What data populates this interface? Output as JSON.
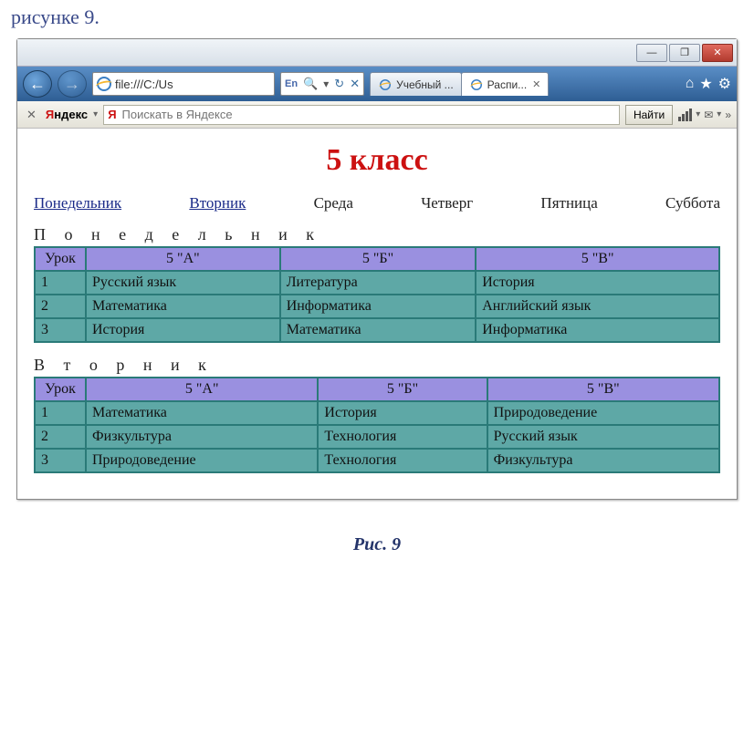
{
  "outer_text": "рисунке 9.",
  "window": {
    "minimize": "—",
    "maximize": "❐",
    "close": "✕"
  },
  "address": {
    "url": "file:///C:/Us",
    "lang": "En",
    "search_glyph": "🔍",
    "dropdown": "▾",
    "refresh": "↻",
    "stop": "✕"
  },
  "tabs": [
    {
      "label": "Учебный ..."
    },
    {
      "label": "Распи...",
      "active": true
    }
  ],
  "navright": {
    "home": "⌂",
    "star": "★",
    "gear": "⚙"
  },
  "yandex": {
    "close": "✕",
    "logo_black": "ндекс",
    "logo_red": "Я",
    "dropdown": "▾",
    "search_prefix_red": "Я",
    "placeholder": "Поискать в Яндексе",
    "find": "Найти",
    "mail": "✉",
    "more": "»"
  },
  "page": {
    "title": "5 класс",
    "days": [
      "Понедельник",
      "Вторник",
      "Среда",
      "Четверг",
      "Пятница",
      "Суббота"
    ],
    "day_links": [
      true,
      true,
      false,
      false,
      false,
      false
    ],
    "sections": [
      {
        "title": "Понедельник",
        "headers": [
          "Урок",
          "5 \"А\"",
          "5 \"Б\"",
          "5 \"В\""
        ],
        "rows": [
          [
            "1",
            "Русский язык",
            "Литература",
            "История"
          ],
          [
            "2",
            "Математика",
            "Информатика",
            "Английский язык"
          ],
          [
            "3",
            "История",
            "Математика",
            "Информатика"
          ]
        ]
      },
      {
        "title": "Вторник",
        "headers": [
          "Урок",
          "5 \"А\"",
          "5 \"Б\"",
          "5 \"В\""
        ],
        "rows": [
          [
            "1",
            "Математика",
            "История",
            "Природоведение"
          ],
          [
            "2",
            "Физкультура",
            "Технология",
            "Русский язык"
          ],
          [
            "3",
            "Природоведение",
            "Технология",
            "Физкультура"
          ]
        ]
      }
    ]
  },
  "caption": "Рис. 9"
}
